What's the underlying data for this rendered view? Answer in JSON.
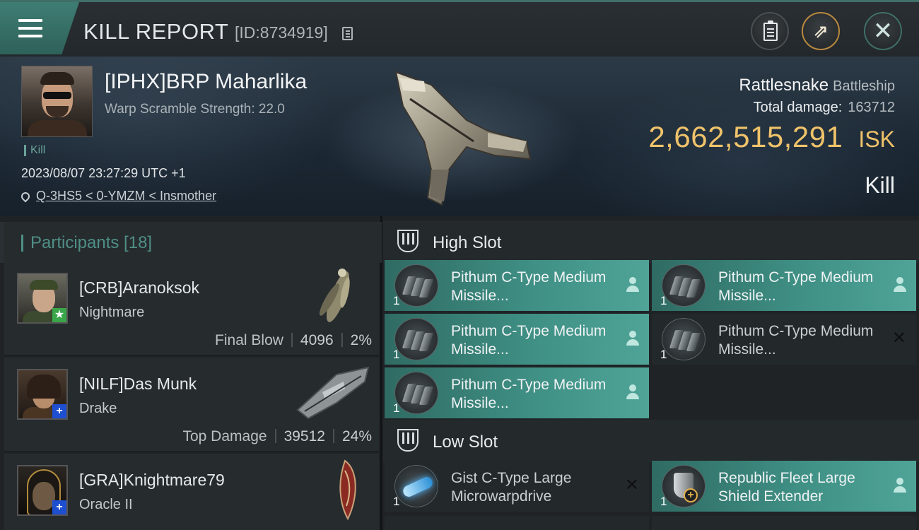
{
  "header": {
    "title": "KILL REPORT",
    "report_id": "[ID:8734919]"
  },
  "victim": {
    "name": "[IPHX]BRP Maharlika",
    "warp_scramble": "Warp Scramble Strength: 22.0",
    "tag": "Kill",
    "datetime": "2023/08/07 23:27:29 UTC +1",
    "location": "Q-3HS5 < 0-YMZM < Insmother",
    "ship_name": "Rattlesnake",
    "ship_class": "Battleship",
    "total_damage_label": "Total damage:",
    "total_damage": "163712",
    "isk_value": "2,662,515,291",
    "isk_unit": "ISK",
    "result": "Kill"
  },
  "participants": {
    "title": "Participants [18]",
    "rows": [
      {
        "name": "[CRB]Aranoksok",
        "ship": "Nightmare",
        "role": "Final Blow",
        "damage": "4096",
        "percent": "2%",
        "badge": "★",
        "badge_color": "#3aa64a"
      },
      {
        "name": "[NILF]Das Munk",
        "ship": "Drake",
        "role": "Top Damage",
        "damage": "39512",
        "percent": "24%",
        "badge": "+",
        "badge_color": "#1f4fd1"
      },
      {
        "name": "[GRA]Knightmare79",
        "ship": "Oracle II",
        "role": "",
        "damage": "",
        "percent": "",
        "badge": "+",
        "badge_color": "#1f4fd1"
      }
    ]
  },
  "slots": {
    "high": {
      "title": "High Slot",
      "modules": [
        {
          "name": "Pithum C-Type Medium Missile...",
          "qty": "1",
          "state": "teal",
          "icon": "missile-launcher-icon"
        },
        {
          "name": "Pithum C-Type Medium Missile...",
          "qty": "1",
          "state": "teal",
          "icon": "missile-launcher-icon"
        },
        {
          "name": "Pithum C-Type Medium Missile...",
          "qty": "1",
          "state": "teal",
          "icon": "missile-launcher-icon"
        },
        {
          "name": "Pithum C-Type Medium Missile...",
          "qty": "1",
          "state": "dark",
          "icon": "missile-launcher-icon"
        },
        {
          "name": "Pithum C-Type Medium Missile...",
          "qty": "1",
          "state": "teal",
          "icon": "missile-launcher-icon"
        }
      ]
    },
    "low": {
      "title": "Low Slot",
      "modules": [
        {
          "name": "Gist C-Type Large Microwarpdrive",
          "qty": "1",
          "state": "dark",
          "icon": "microwarpdrive-icon"
        },
        {
          "name": "Republic Fleet Large Shield Extender",
          "qty": "1",
          "state": "teal",
          "icon": "shield-extender-icon"
        }
      ]
    }
  }
}
